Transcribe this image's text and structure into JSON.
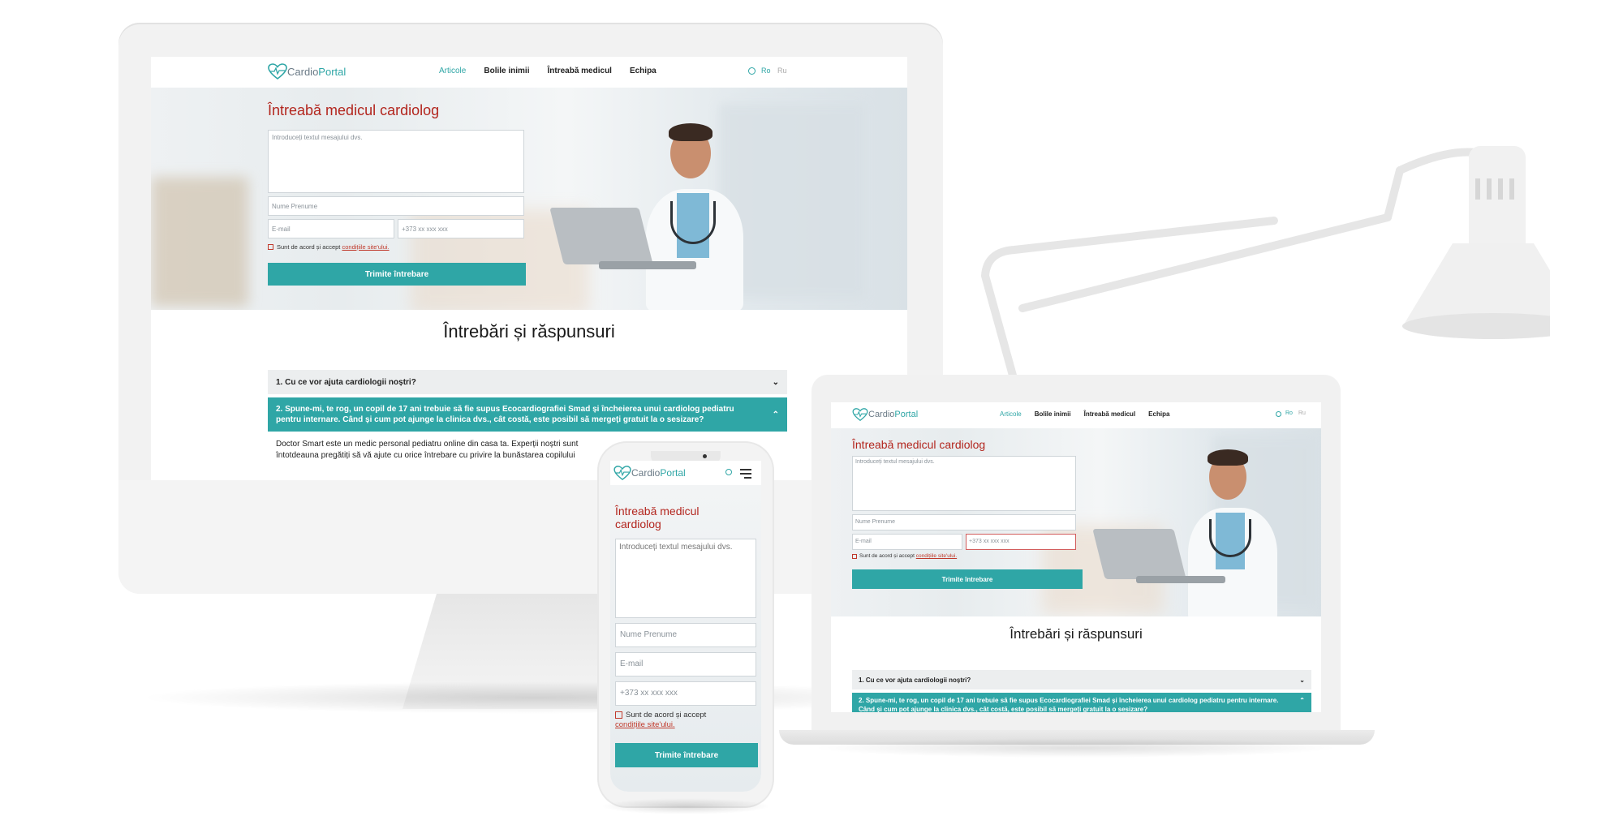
{
  "site": {
    "logo_prefix": "Cardio",
    "logo_suffix": "Portal",
    "nav": [
      "Articole",
      "Bolile inimii",
      "Întreabă medicul",
      "Echipa"
    ],
    "nav_active_index": 0,
    "lang": [
      "Ro",
      "Ru"
    ],
    "search_icon": "search-icon",
    "menu_icon": "hamburger-menu-icon",
    "hero_title": "Întreabă medicul cardiolog",
    "message_placeholder": "Introduceți textul mesajului dvs.",
    "name_placeholder": "Nume Prenume",
    "email_placeholder": "E-mail",
    "phone_placeholder": "+373 xx xxx xxx",
    "agree_text": "Sunt de acord și accept ",
    "agree_link": "condițiile site'ului.",
    "submit_label": "Trimite întrebare",
    "qa_title": "Întrebări și răspunsuri",
    "faq": [
      {
        "q": "1. Cu ce vor ajuta cardiologii noștri?"
      },
      {
        "q": "2. Spune-mi, te rog, un copil de 17 ani trebuie să fie supus Ecocardiografiei Smad și încheierea unui cardiolog pediatru pentru internare. Când și cum pot ajunge la clinica dvs., cât costă, este posibil să mergeți gratuit la o sesizare?"
      }
    ],
    "answer_line1": "Doctor Smart este un medic personal pediatru online din casa ta. Experții noștri sunt",
    "answer_line2": "întotdeauna pregătiți să vă ajute cu orice întrebare cu privire la bunăstarea copilului"
  },
  "colors": {
    "accent": "#2fa6a6",
    "title_red": "#b3261e",
    "link_red": "#c0392b"
  }
}
